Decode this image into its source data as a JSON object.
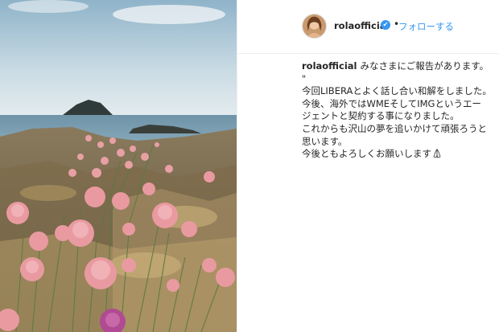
{
  "header": {
    "username": "rolaofficial",
    "verified_icon": "verified-badge-icon",
    "separator": "•",
    "follow_label": "フォローする"
  },
  "caption": {
    "username": "rolaofficial",
    "first_line": "みなさまにご報告があります。",
    "lines": [
      "\"",
      "今回LIBERAとよく話し合い和解をしました。",
      "今後、海外ではWMEそしてIMGというエー",
      "ジェントと契約する事になりました。",
      "これからも沢山の夢を追いかけて頑張ろうと",
      "思います。",
      "今後ともよろしくお願いします"
    ],
    "trailing_icon": "pray-hands-emoji"
  },
  "colors": {
    "link_blue": "#3897f0",
    "text": "#262626",
    "border": "#efefef"
  }
}
